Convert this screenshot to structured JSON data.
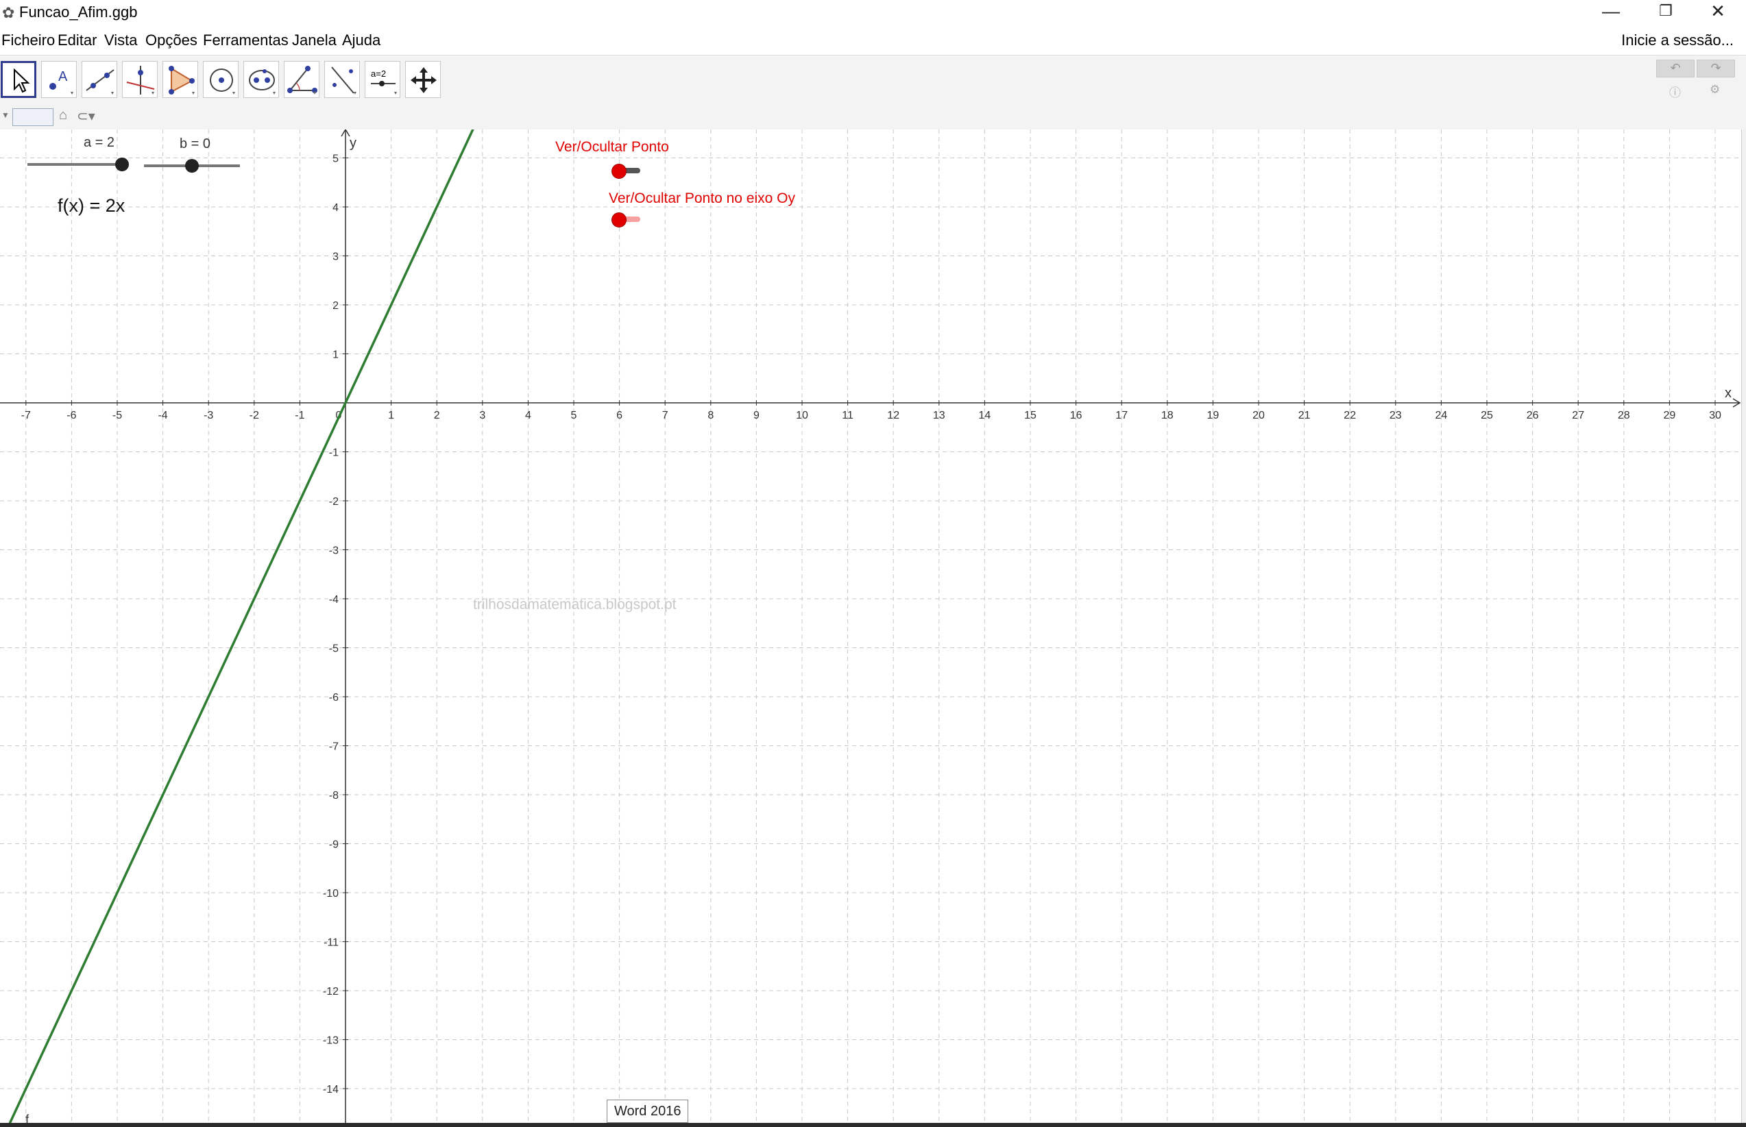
{
  "window": {
    "title": "Funcao_Afim.ggb",
    "minimize_glyph": "—",
    "restore_glyph": "❐",
    "close_glyph": "✕",
    "app_icon": "geogebra-icon"
  },
  "menu": [
    "Ficheiro",
    "Editar",
    "Vista",
    "Opções",
    "Ferramentas",
    "Janela",
    "Ajuda"
  ],
  "signin": "Inicie a sessão...",
  "tools": [
    "move-tool",
    "point-tool",
    "line-tool",
    "perpendicular-tool",
    "polygon-tool",
    "circle-tool",
    "conic-tool",
    "angle-tool",
    "reflect-tool",
    "slider-tool",
    "move-view-tool"
  ],
  "slider_tool_label": "a=2",
  "graphics": {
    "sliders": [
      {
        "label": "a = 2",
        "value": 2,
        "min": -5,
        "max": 5
      },
      {
        "label": "b = 0",
        "value": 0,
        "min": -5,
        "max": 5
      }
    ],
    "function_text": "f(x) = 2x",
    "function_label": "f",
    "function": {
      "slope": 2,
      "intercept": 0,
      "color": "#2e7d32"
    },
    "axis_x_label": "x",
    "axis_y_label": "y",
    "x_range": [
      -7.5,
      30.3
    ],
    "y_range": [
      -14.8,
      5.6
    ],
    "x_ticks": [
      "-7",
      "-6",
      "-5",
      "-4",
      "-3",
      "-2",
      "-1",
      "0",
      "1",
      "2",
      "3",
      "4",
      "5",
      "6",
      "7",
      "8",
      "9",
      "10",
      "11",
      "12",
      "13",
      "14",
      "15",
      "16",
      "17",
      "18",
      "19",
      "20",
      "21",
      "22",
      "23",
      "24",
      "25",
      "26",
      "27",
      "28",
      "29",
      "30"
    ],
    "y_ticks": [
      "5",
      "4",
      "3",
      "2",
      "1",
      "-1",
      "-2",
      "-3",
      "-4",
      "-5",
      "-6",
      "-7",
      "-8",
      "-9",
      "-10",
      "-11",
      "-12",
      "-13",
      "-14"
    ],
    "checkboxes": [
      {
        "label": "Ver/Ocultar Ponto",
        "color": "#e00000"
      },
      {
        "label": "Ver/Ocultar Ponto no eixo Oy",
        "color": "#e00000"
      }
    ],
    "watermark": "trilhosdamatematica.blogspot.pt"
  },
  "tooltip": "Word 2016"
}
